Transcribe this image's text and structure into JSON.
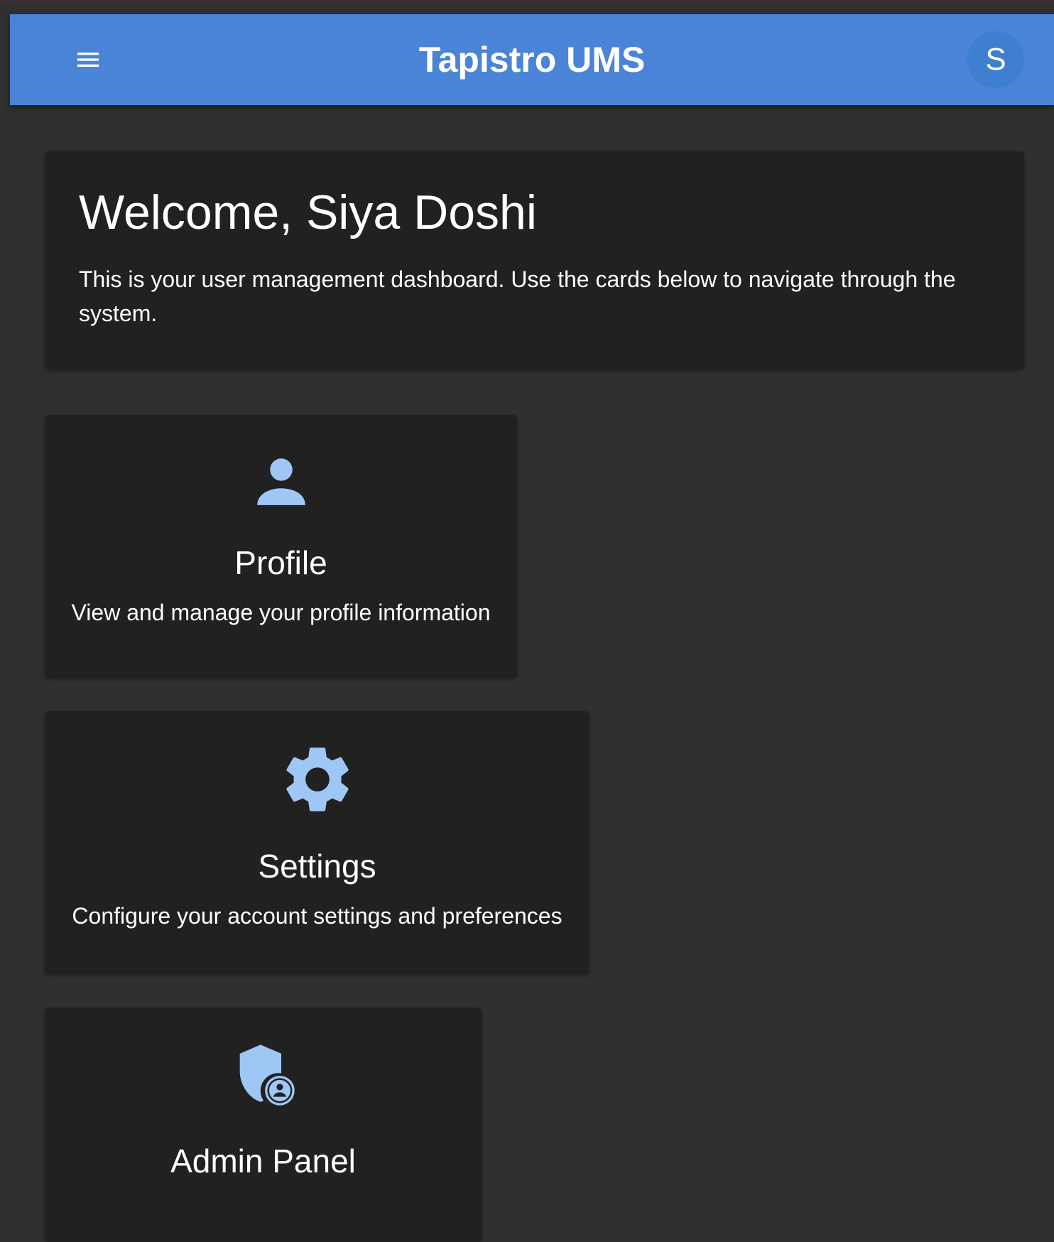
{
  "app": {
    "title": "Tapistro UMS",
    "accent_color": "#4a84d6",
    "menu_icon": "menu-icon",
    "avatar_initial": "S"
  },
  "welcome": {
    "title": "Welcome, Siya Doshi",
    "text": "This is your user management dashboard. Use the cards below to navigate through the system."
  },
  "cards": [
    {
      "icon": "person-icon",
      "title": "Profile",
      "description": "View and manage your profile information"
    },
    {
      "icon": "gear-icon",
      "title": "Settings",
      "description": "Configure your account settings and preferences"
    },
    {
      "icon": "admin-shield-icon",
      "title": "Admin Panel",
      "description": ""
    }
  ],
  "icon_color": "#9ec7f5"
}
